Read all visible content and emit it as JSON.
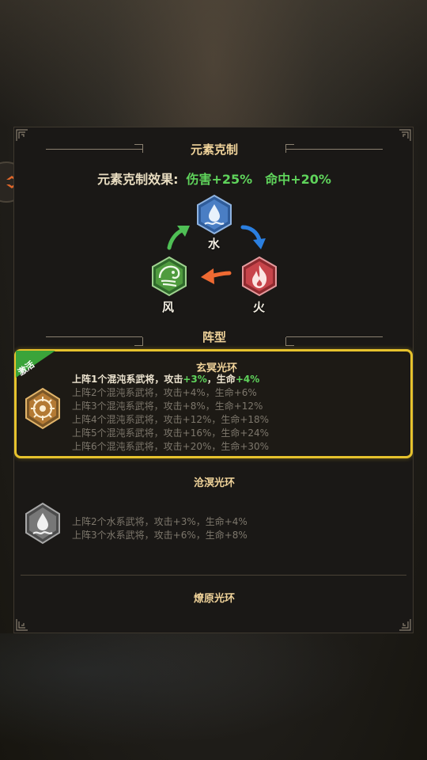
{
  "element_section": {
    "title": "元素克制",
    "effect_label": "元素克制效果:",
    "effect_values": [
      "伤害+25%",
      "命中+20%"
    ],
    "elements": [
      {
        "name": "水",
        "icon": "water-icon",
        "color": "#4a7ec4"
      },
      {
        "name": "火",
        "icon": "fire-icon",
        "color": "#c7444a"
      },
      {
        "name": "风",
        "icon": "wind-icon",
        "color": "#4f9b3e"
      }
    ]
  },
  "formation_section": {
    "title": "阵型",
    "auras": [
      {
        "name": "玄冥光环",
        "badge": "激活",
        "active": true,
        "icon": "chaos-icon",
        "lines": [
          {
            "prefix": "上阵1个混沌系武将，攻击",
            "atk": "+3%",
            "mid": "，生命",
            "hp": "+4%"
          },
          {
            "text": "上阵2个混沌系武将，攻击+4%，生命+6%"
          },
          {
            "text": "上阵3个混沌系武将，攻击+8%，生命+12%"
          },
          {
            "text": "上阵4个混沌系武将，攻击+12%，生命+18%"
          },
          {
            "text": "上阵5个混沌系武将，攻击+16%，生命+24%"
          },
          {
            "text": "上阵6个混沌系武将，攻击+20%，生命+30%"
          }
        ]
      },
      {
        "name": "沧溟光环",
        "active": false,
        "icon": "water-icon",
        "lines": [
          {
            "text": "上阵2个水系武将，攻击+3%，生命+4%"
          },
          {
            "text": "上阵3个水系武将，攻击+6%，生命+8%"
          }
        ]
      },
      {
        "name": "燎原光环",
        "active": false
      }
    ]
  }
}
